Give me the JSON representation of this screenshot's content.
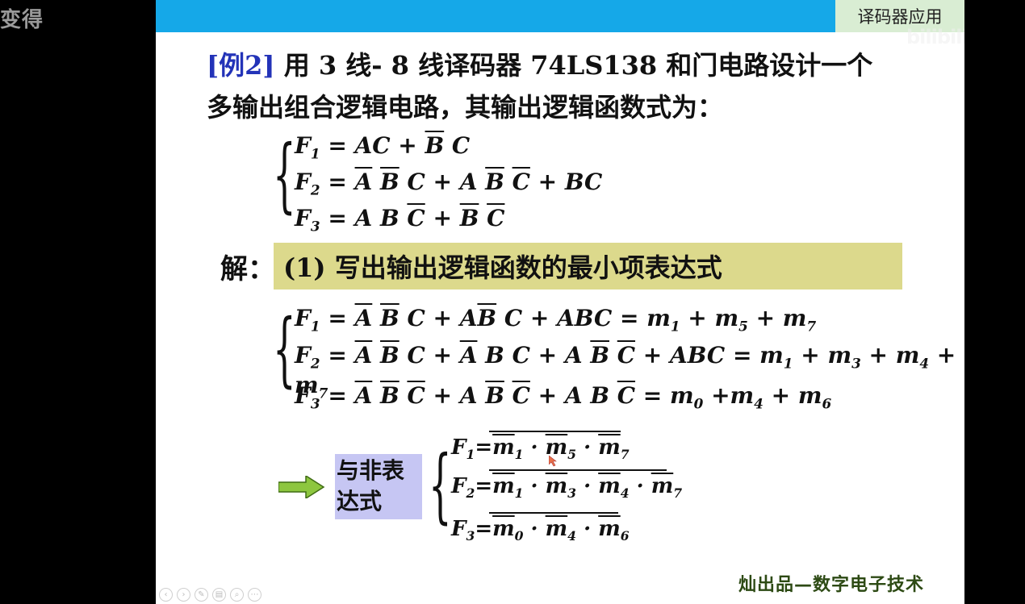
{
  "overlay": {
    "corner_text": "变得"
  },
  "slide": {
    "section_label": "译码器应用",
    "watermark": "bilibili",
    "title": {
      "example_tag": "[例2]",
      "line1": "用 3 线- 8 线译码器 74LS138 和门电路设计一个",
      "line2": "多输出组合逻辑电路，其输出逻辑函数式为："
    },
    "given": {
      "f1": "F1 = AC + B̄C",
      "f2": "F2 = ĀB̄C + AB̄C̄ + BC",
      "f3": "F3 = ABC̄ + B̄C̄"
    },
    "solution": {
      "label": "解：",
      "step": "(1) 写出输出逻辑函数的最小项表达式"
    },
    "minterms": {
      "f1": "F1 = ĀB̄C + AB̄C + ABC = m1 + m5 + m7",
      "f2": "F2 = ĀB̄C + ĀBC + AB̄C̄ + ABC = m1 + m3 + m4 + m7",
      "f3": "F3 = ĀB̄C̄ + AB̄C̄ + ABC̄ = m0 + m4 + m6"
    },
    "nand": {
      "label_line1": "与非表",
      "label_line2": "达式",
      "f1": "F1 = (m̄1 · m̄5 · m̄7)‾",
      "f2": "F2 = (m̄1 · m̄3 · m̄4 · m̄7)‾",
      "f3": "F3 = (m̄0 · m̄4 · m̄6)‾"
    },
    "footer": "灿出品—数字电子技术",
    "controls": [
      "prev-icon",
      "next-icon",
      "pen-icon",
      "slides-icon",
      "zoom-icon",
      "more-icon"
    ]
  }
}
